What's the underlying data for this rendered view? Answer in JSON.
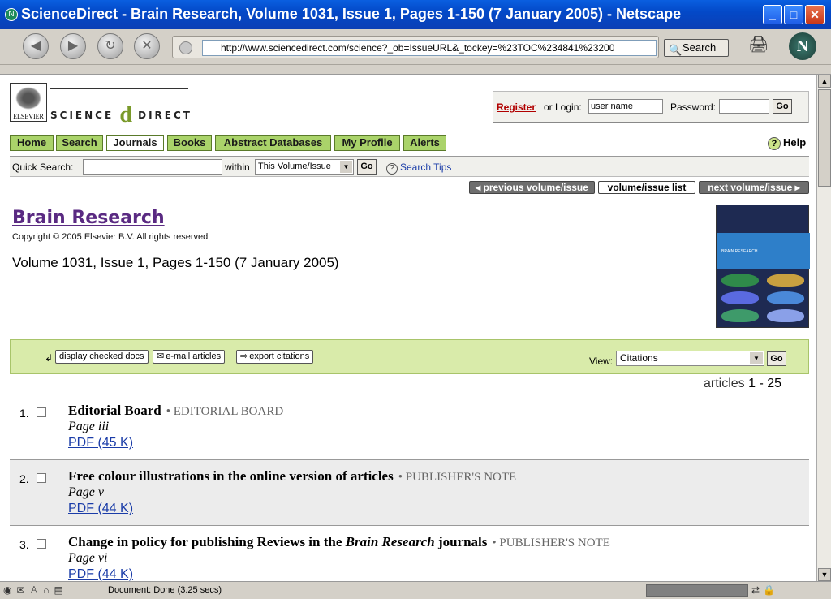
{
  "window": {
    "title": "ScienceDirect - Brain Research, Volume 1031, Issue 1, Pages 1-150 (7 January 2005) - Netscape"
  },
  "toolbar": {
    "url": "http://www.sciencedirect.com/science?_ob=IssueURL&_tockey=%23TOC%234841%23200",
    "search_label": "Search"
  },
  "header": {
    "publisher": "ELSEVIER",
    "brand_left": "SCIENCE",
    "brand_at": "d",
    "brand_right": "DIRECT",
    "register_label": "Register",
    "or_login_label": "or Login:",
    "username_value": "user name",
    "password_label": "Password:",
    "go_label": "Go"
  },
  "nav": {
    "tabs": [
      {
        "label": "Home"
      },
      {
        "label": "Search"
      },
      {
        "label": "Journals"
      },
      {
        "label": "Books"
      },
      {
        "label": "Abstract Databases"
      },
      {
        "label": "My Profile"
      },
      {
        "label": "Alerts"
      }
    ],
    "help_label": "Help"
  },
  "quick_search": {
    "label": "Quick Search:",
    "within_label": "within",
    "scope_value": "This Volume/Issue",
    "go_label": "Go",
    "tips_label": "Search Tips"
  },
  "volume_nav": {
    "previous_label": "previous volume/issue",
    "list_label": "volume/issue list",
    "next_label": "next volume/issue"
  },
  "journal": {
    "title": "Brain Research",
    "copyright": "Copyright © 2005 Elsevier B.V. All rights reserved",
    "volume_info": "Volume 1031, Issue 1, Pages 1-150 (7 January 2005)",
    "cover_title": "BRAIN RESEARCH"
  },
  "actions": {
    "display_checked_label": "display checked docs",
    "email_label": "e-mail articles",
    "export_label": "export citations",
    "view_label": "View:",
    "view_value": "Citations",
    "view_go_label": "Go"
  },
  "results": {
    "prefix": "articles",
    "range": "1 - 25"
  },
  "articles": [
    {
      "num": "1.",
      "title": "Editorial Board",
      "type": "• EDITORIAL BOARD",
      "page": "Page iii",
      "pdf": "PDF (45 K)"
    },
    {
      "num": "2.",
      "title": "Free colour illustrations in the online version of articles",
      "type": "• PUBLISHER'S NOTE",
      "page": "Page v",
      "pdf": "PDF (44 K)"
    },
    {
      "num": "3.",
      "title_pre": "Change in policy for publishing Reviews in the ",
      "title_italic": "Brain Research",
      "title_post": " journals",
      "type": "• PUBLISHER'S NOTE",
      "page": "Page vi",
      "pdf": "PDF (44 K)"
    }
  ],
  "status": {
    "text": "Document: Done (3.25 secs)"
  }
}
